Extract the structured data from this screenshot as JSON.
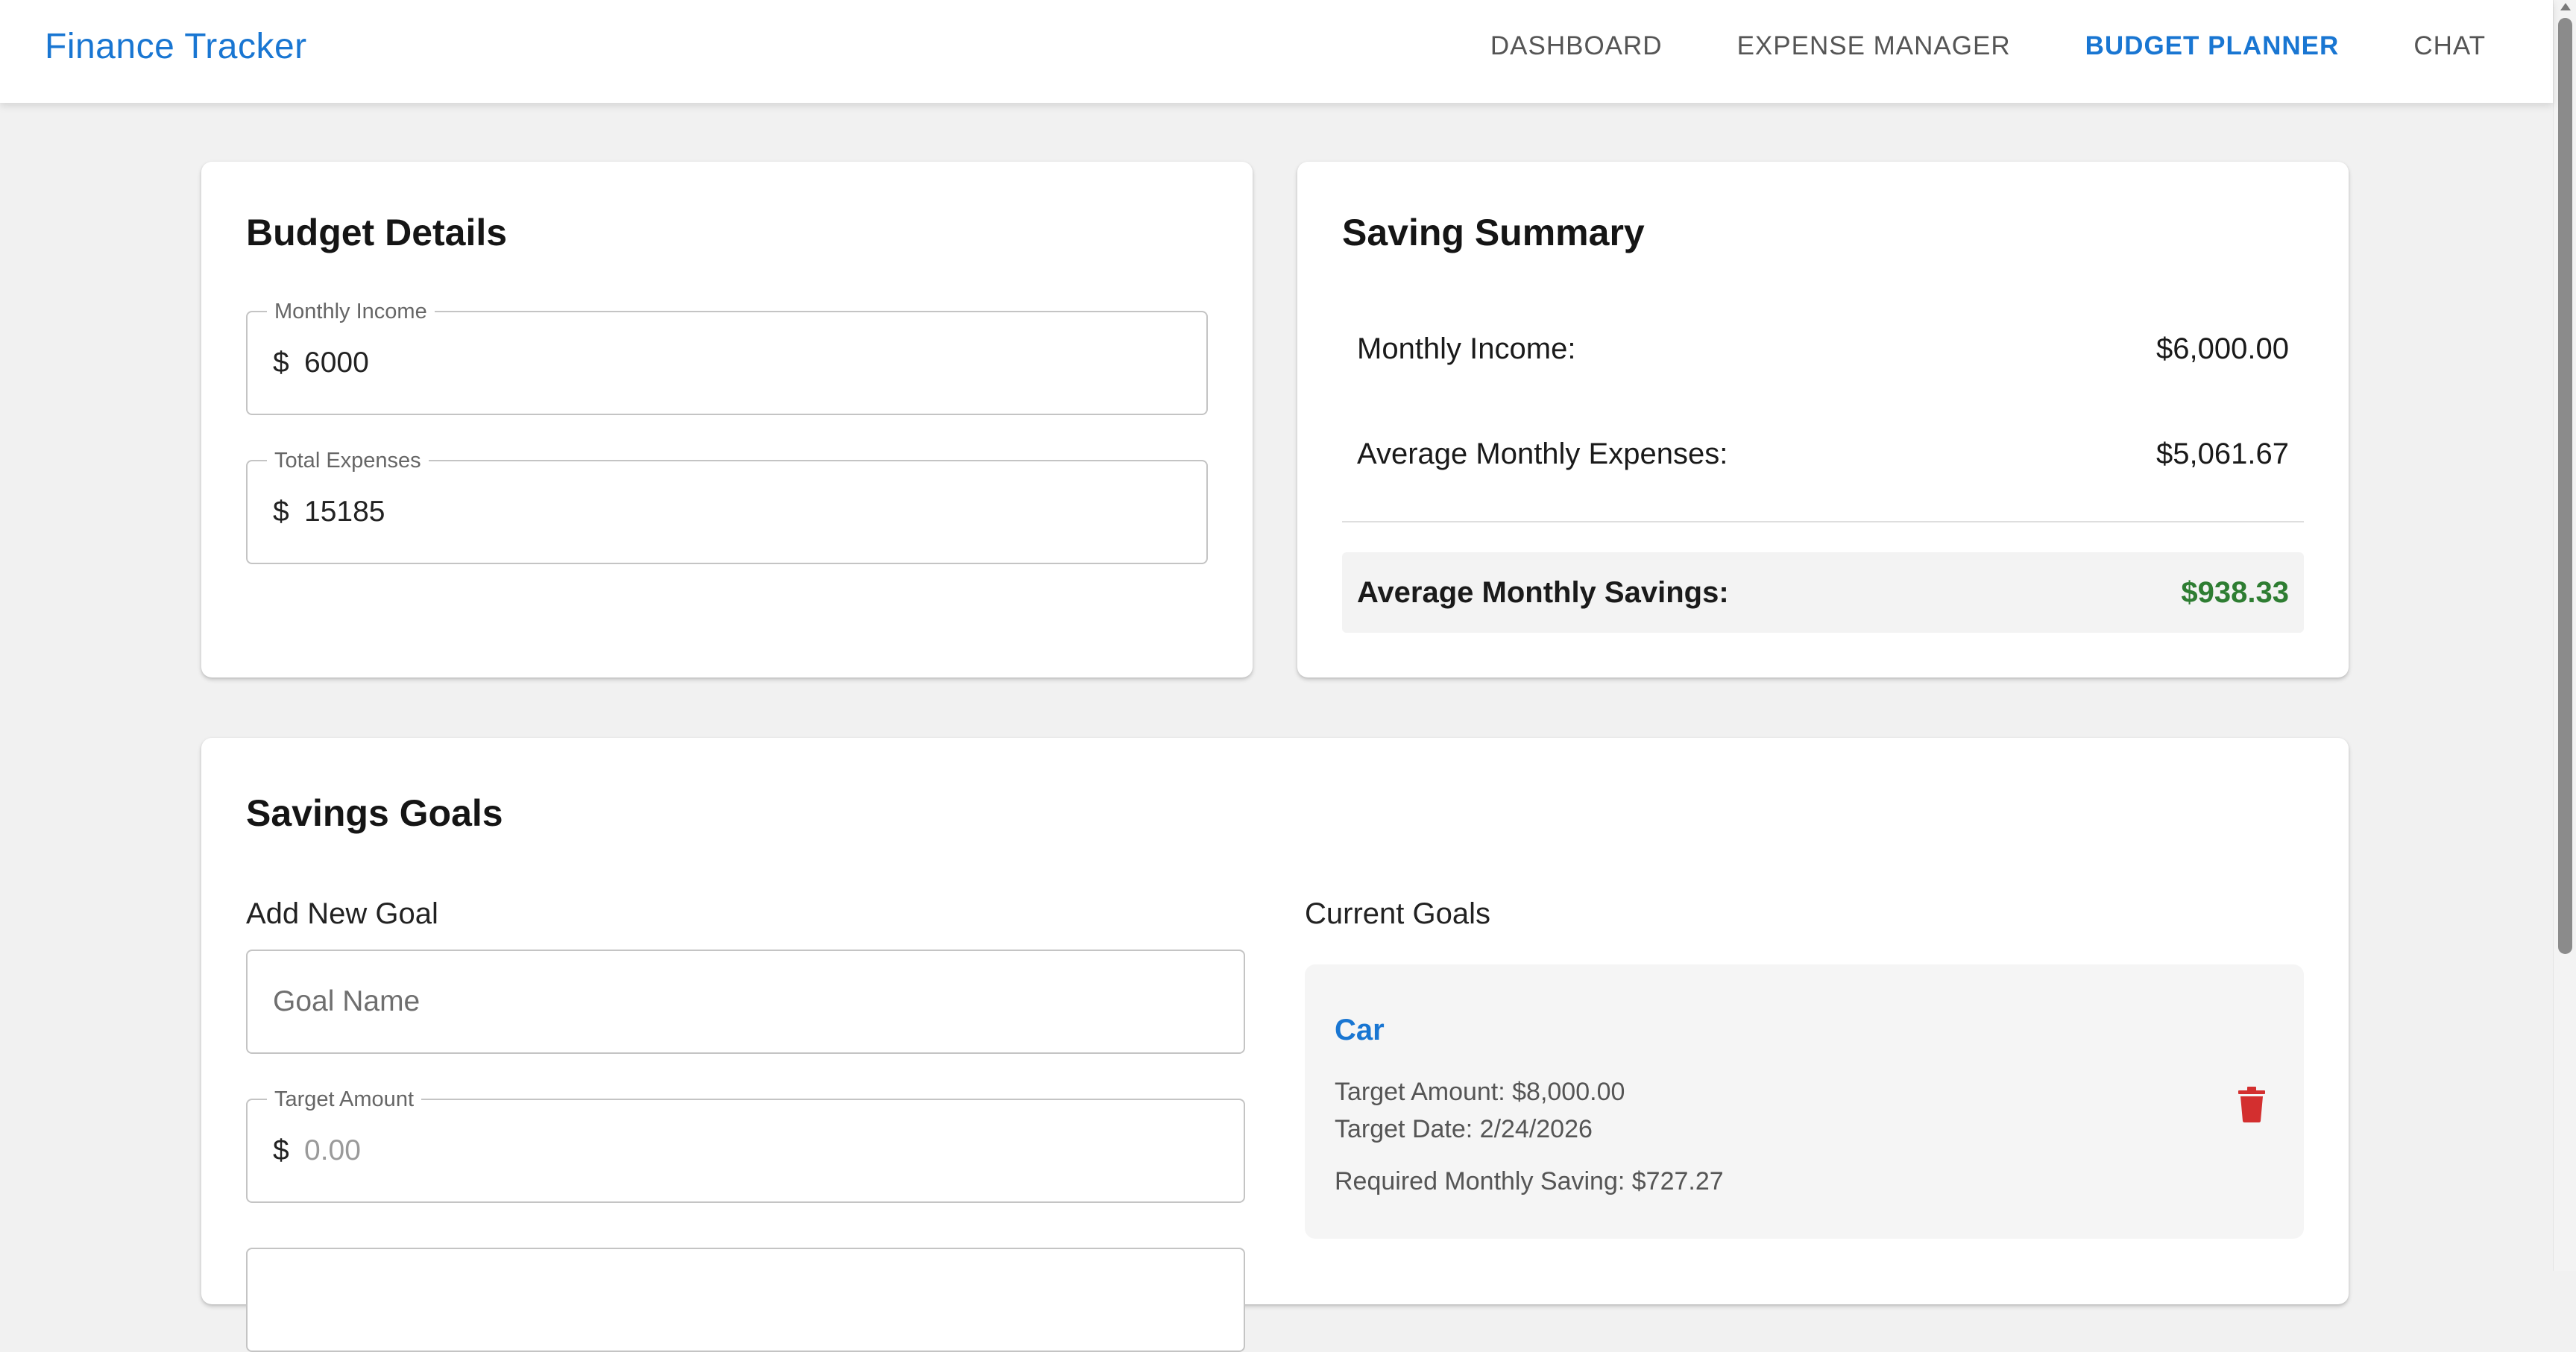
{
  "app": {
    "title": "Finance Tracker"
  },
  "nav": [
    {
      "label": "DASHBOARD",
      "active": false
    },
    {
      "label": "EXPENSE MANAGER",
      "active": false
    },
    {
      "label": "BUDGET PLANNER",
      "active": true
    },
    {
      "label": "CHAT",
      "active": false
    }
  ],
  "budget_details": {
    "title": "Budget Details",
    "monthly_income": {
      "label": "Monthly Income",
      "prefix": "$",
      "value": "6000"
    },
    "total_expenses": {
      "label": "Total Expenses",
      "prefix": "$",
      "value": "15185"
    }
  },
  "saving_summary": {
    "title": "Saving Summary",
    "rows": [
      {
        "label": "Monthly Income:",
        "value": "$6,000.00"
      },
      {
        "label": "Average Monthly Expenses:",
        "value": "$5,061.67"
      }
    ],
    "savings": {
      "label": "Average Monthly Savings:",
      "value": "$938.33"
    }
  },
  "savings_goals": {
    "title": "Savings Goals",
    "add_new": {
      "heading": "Add New Goal",
      "goal_name_placeholder": "Goal Name",
      "target_amount": {
        "label": "Target Amount",
        "prefix": "$",
        "placeholder": "0.00"
      }
    },
    "current": {
      "heading": "Current Goals",
      "goals": [
        {
          "name": "Car",
          "target_amount": "Target Amount: $8,000.00",
          "target_date": "Target Date: 2/24/2026",
          "required_monthly": "Required Monthly Saving: $727.27"
        }
      ]
    }
  },
  "colors": {
    "primary": "#1976d2",
    "savings_green": "#2e7d32",
    "delete_red": "#d32f2f",
    "background": "#f1f1f1"
  },
  "icons": {
    "delete": "trash-icon"
  }
}
